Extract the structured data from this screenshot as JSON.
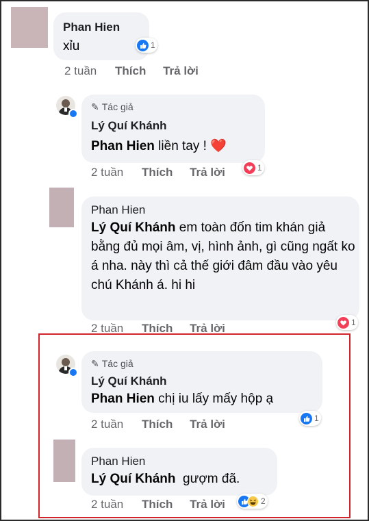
{
  "comments": [
    {
      "author": "Phan Hien",
      "text": "xỉu",
      "time": "2 tuần",
      "like": "Thích",
      "reply": "Trả lời",
      "reaction_count": "1"
    },
    {
      "badge": "Tác giả",
      "author": "Lý Quí Khánh",
      "mention": "Phan Hien",
      "text": " liền tay ! ❤️",
      "time": "2 tuần",
      "like": "Thích",
      "reply": "Trả lời",
      "reaction_count": "1"
    },
    {
      "author": "Phan Hien",
      "mention": "Lý Quí Khánh",
      "text": " em toàn đốn tim khán giả bằng đủ mọi âm, vị, hình ảnh, gì cũng ngất ko á nha. này thì cả thế giới đâm đầu vào yêu chú Khánh á. hi hi",
      "time": "2 tuần",
      "like": "Thích",
      "reply": "Trả lời",
      "reaction_count": "1"
    },
    {
      "badge": "Tác giả",
      "author": "Lý Quí Khánh",
      "mention": "Phan Hien",
      "text": " chị iu lấy mấy hộp ạ",
      "time": "2 tuần",
      "like": "Thích",
      "reply": "Trả lời",
      "reaction_count": "1"
    },
    {
      "author": "Phan Hien",
      "mention": "Lý Quí Khánh",
      "text": "  gượm đã.",
      "time": "2 tuần",
      "like": "Thích",
      "reply": "Trả lời",
      "reaction_count": "2"
    }
  ],
  "colors": {
    "bubble": "#f0f2f5",
    "like": "#1877f2",
    "love": "#f33e58",
    "haha": "#f7c94b",
    "highlight": "#d0242a"
  }
}
